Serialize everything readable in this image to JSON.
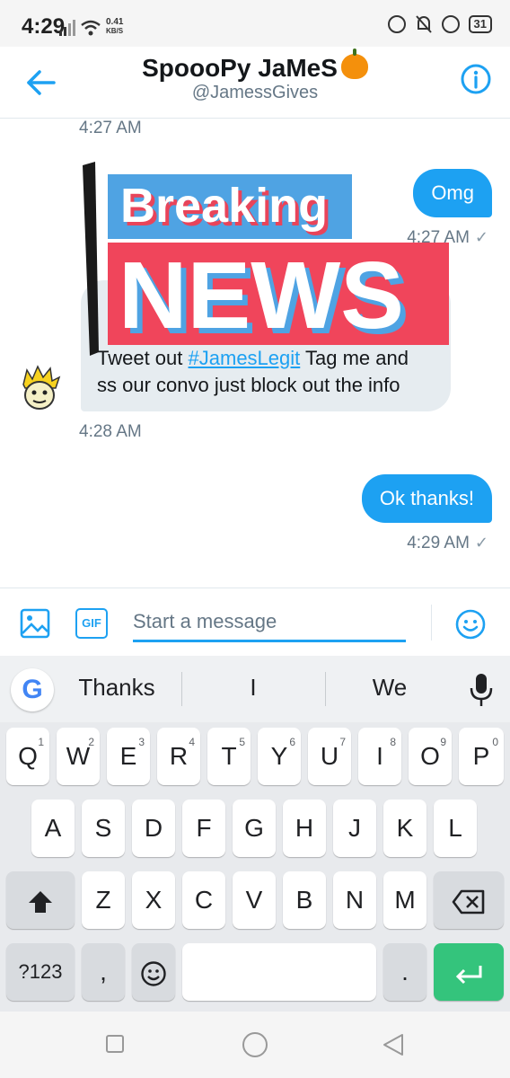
{
  "status_bar": {
    "time": "4:29",
    "net_speed": "0.41",
    "net_unit": "KB/S",
    "battery": "31"
  },
  "header": {
    "name": "SpoooPy JaMeS",
    "handle": "@JamessGives"
  },
  "messages": {
    "ts_top": "4:27 AM",
    "out1_text": "Omg",
    "out1_ts": "4:27 AM",
    "in1_line1_pre": "Tweet out ",
    "in1_hashtag": "#JamesLegit",
    "in1_line1_post": " Tag me and",
    "in1_line2": "ss our convo just block out the info",
    "in1_ts": "4:28 AM",
    "out2_text": "Ok thanks!",
    "out2_ts": "4:29 AM",
    "check": "✓"
  },
  "overlay": {
    "line1": "Breaking",
    "line2": "NEWS"
  },
  "composer": {
    "gif_label": "GIF",
    "placeholder": "Start a message"
  },
  "keyboard": {
    "google": "G",
    "suggestions": [
      "Thanks",
      "I",
      "We"
    ],
    "row1": [
      "Q",
      "W",
      "E",
      "R",
      "T",
      "Y",
      "U",
      "I",
      "O",
      "P"
    ],
    "row1_hints": [
      "1",
      "2",
      "3",
      "4",
      "5",
      "6",
      "7",
      "8",
      "9",
      "0"
    ],
    "row2": [
      "A",
      "S",
      "D",
      "F",
      "G",
      "H",
      "J",
      "K",
      "L"
    ],
    "row3": [
      "Z",
      "X",
      "C",
      "V",
      "B",
      "N",
      "M"
    ],
    "symbols_label": "?123",
    "comma": ",",
    "period": "."
  },
  "colors": {
    "accent": "#1da1f2",
    "news_red": "#f0455b",
    "news_blue": "#4fa3e3",
    "enter_green": "#34c47c"
  }
}
